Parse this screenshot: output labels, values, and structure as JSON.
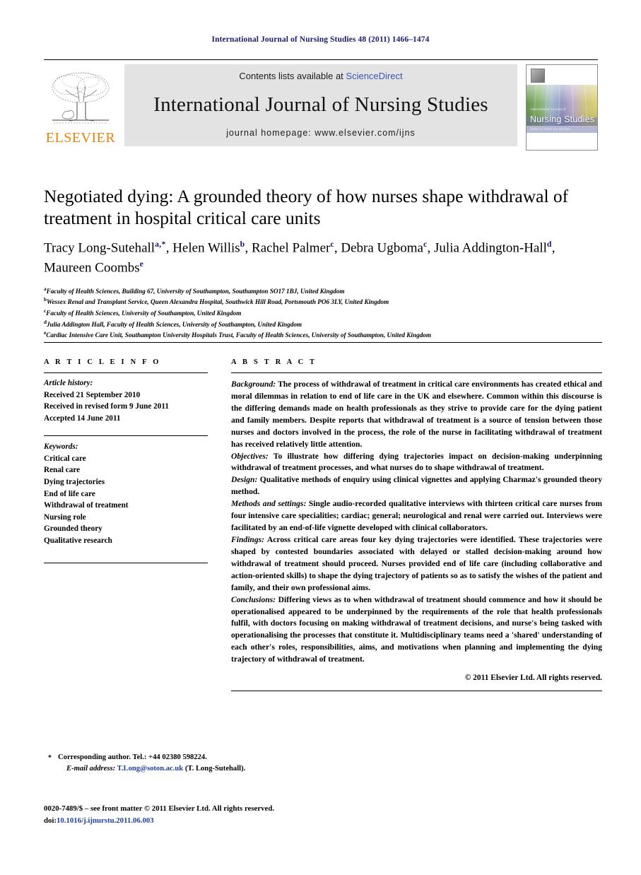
{
  "running_head": "International Journal of Nursing Studies 48 (2011) 1466–1474",
  "masthead": {
    "publisher": "ELSEVIER",
    "contents_prefix": "Contents lists available at ",
    "contents_link": "ScienceDirect",
    "journal_title": "International Journal of Nursing Studies",
    "homepage": "journal homepage: www.elsevier.com/ijns",
    "cover": {
      "kicker": "International Journal of",
      "name": "Nursing Studies",
      "sub": "Editor-in-Chief: Ian Norman"
    }
  },
  "article": {
    "title": "Negotiated dying: A grounded theory of how nurses shape withdrawal of treatment in hospital critical care units",
    "authors": [
      {
        "name": "Tracy Long-Sutehall",
        "marks": "a,*"
      },
      {
        "name": "Helen Willis",
        "marks": "b"
      },
      {
        "name": "Rachel Palmer",
        "marks": "c"
      },
      {
        "name": "Debra Ugboma",
        "marks": "c"
      },
      {
        "name": "Julia Addington-Hall",
        "marks": "d"
      },
      {
        "name": "Maureen Coombs",
        "marks": "e"
      }
    ],
    "affiliations": [
      {
        "mark": "a",
        "text": "Faculty of Health Sciences, Building 67, University of Southampton, Southampton SO17 1BJ, United Kingdom"
      },
      {
        "mark": "b",
        "text": "Wessex Renal and Transplant Service, Queen Alexandra Hospital, Southwick Hill Road, Portsmouth PO6 3LY, United Kingdom"
      },
      {
        "mark": "c",
        "text": "Faculty of Health Sciences, University of Southampton, United Kingdom"
      },
      {
        "mark": "d",
        "text": "Julia Addington Hall, Faculty of Health Sciences, University of Southampton, United Kingdom"
      },
      {
        "mark": "e",
        "text": "Cardiac Intensive Care Unit, Southampton University Hospitals Trust, Faculty of Health Sciences, University of Southampton, United Kingdom"
      }
    ]
  },
  "article_info": {
    "heading": "A R T I C L E   I N F O",
    "history_label": "Article history:",
    "history": [
      "Received 21 September 2010",
      "Received in revised form 9 June 2011",
      "Accepted 14 June 2011"
    ],
    "keywords_label": "Keywords:",
    "keywords": [
      "Critical care",
      "Renal care",
      "Dying trajectories",
      "End of life care",
      "Withdrawal of treatment",
      "Nursing role",
      "Grounded theory",
      "Qualitative research"
    ]
  },
  "abstract": {
    "heading": "A B S T R A C T",
    "sections": [
      {
        "label": "Background:",
        "text": " The process of withdrawal of treatment in critical care environments has created ethical and moral dilemmas in relation to end of life care in the UK and elsewhere. Common within this discourse is the differing demands made on health professionals as they strive to provide care for the dying patient and family members. Despite reports that withdrawal of treatment is a source of tension between those nurses and doctors involved in the process, the role of the nurse in facilitating withdrawal of treatment has received relatively little attention."
      },
      {
        "label": "Objectives:",
        "text": " To illustrate how differing dying trajectories impact on decision-making underpinning withdrawal of treatment processes, and what nurses do to shape withdrawal of treatment."
      },
      {
        "label": "Design:",
        "text": " Qualitative methods of enquiry using clinical vignettes and applying Charmaz's grounded theory method."
      },
      {
        "label": "Methods and settings:",
        "text": " Single audio-recorded qualitative interviews with thirteen critical care nurses from four intensive care specialities; cardiac; general; neurological and renal were carried out. Interviews were facilitated by an end-of-life vignette developed with clinical collaborators."
      },
      {
        "label": "Findings:",
        "text": " Across critical care areas four key dying trajectories were identified. These trajectories were shaped by contested boundaries associated with delayed or stalled decision-making around how withdrawal of treatment should proceed. Nurses provided end of life care (including collaborative and action-oriented skills) to shape the dying trajectory of patients so as to satisfy the wishes of the patient and family, and their own professional aims."
      },
      {
        "label": "Conclusions:",
        "text": " Differing views as to when withdrawal of treatment should commence and how it should be operationalised appeared to be underpinned by the requirements of the role that health professionals fulfil, with doctors focusing on making withdrawal of treatment decisions, and nurse's being tasked with operationalising the processes that constitute it. Multidisciplinary teams need a 'shared' understanding of each other's roles, responsibilities, aims, and motivations when planning and implementing the dying trajectory of withdrawal of treatment."
      }
    ],
    "copyright": "© 2011 Elsevier Ltd. All rights reserved."
  },
  "footnote": {
    "corresponding": "Corresponding author. Tel.: +44 02380 598224.",
    "email_label": "E-mail address:",
    "email": "T.Long@soton.ac.uk",
    "email_owner": "(T. Long-Sutehall)."
  },
  "imprint": {
    "front_matter": "0020-7489/$ – see front matter © 2011 Elsevier Ltd. All rights reserved.",
    "doi_label": "doi:",
    "doi": "10.1016/j.ijnurstu.2011.06.003"
  },
  "colors": {
    "running_head": "#1b1b6f",
    "elsevier_orange": "#E8850C",
    "link_blue": "#3a55b4",
    "banner_bg": "#e3e3e3"
  }
}
